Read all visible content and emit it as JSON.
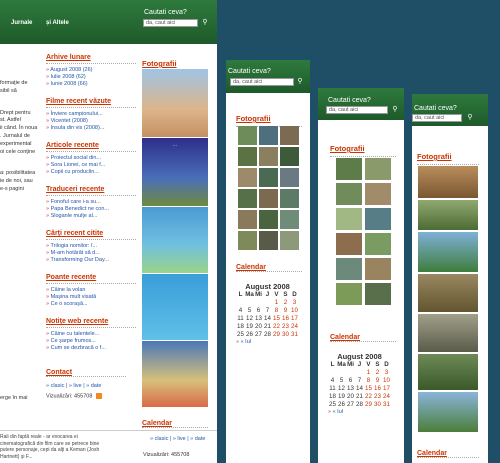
{
  "main": {
    "nav": [
      "Jurnale",
      "și Altele"
    ],
    "search": {
      "label": "Cautati ceva?",
      "placeholder": "da, caut aici"
    },
    "left_text": [
      "formaţie de",
      "sibil să",
      "Drept pentru",
      "st. Astfel",
      "ii când. În noua",
      ". Jurnalul de",
      "experimental",
      "oi cele conţine",
      "a: posibilitatea",
      "ie de noi, sau",
      "e-s pagini",
      "erge în mai"
    ],
    "sections": [
      {
        "title": "Arhive lunare",
        "links": [
          "August 2008 (26)",
          "Iulie 2008 (62)",
          "Iunie 2008 (66)"
        ]
      },
      {
        "title": "Filme recent văzute",
        "links": [
          "Înviere campionului...",
          "Vicentet (2008)",
          "Insula din vis (2008)..."
        ]
      },
      {
        "title": "Articole recente",
        "links": [
          "Proiectul social din...",
          "Sora Lionei, ce mai f...",
          "Copii cu produclin..."
        ]
      },
      {
        "title": "Traduceri recente",
        "links": [
          "Fonoful care i-a su...",
          "Papa Benedict ne con...",
          "Sloganle mulţe al..."
        ]
      },
      {
        "title": "Cărţi recent citite",
        "links": [
          "Trilogia nomilor: î...",
          "M-am hotărât să d...",
          "Transforming Our Day..."
        ]
      },
      {
        "title": "Poante recente",
        "links": [
          "Câine la volan",
          "Maşina mult visată",
          "Ce o scoraşă..."
        ]
      },
      {
        "title": "Notiţe web recente",
        "links": [
          "Câine cu talentele...",
          "Ce şarpe frumos...",
          "Cum se dezbracă o f..."
        ]
      }
    ],
    "contact": {
      "title": "Contact",
      "feeds": "» clasic | » live | » date",
      "visits": "Vizualizări: 455708"
    },
    "fotografii": "Fotografii",
    "calendar": "Calendar",
    "bottom_text": "Rali din faptă reale - ar evocarea ei cinematografică din film care se petrece bine putere personaje, cepi da alţi a Keman (Josh Hartnett) şi F...",
    "bottom_feeds": "» clasic | » live | » date",
    "bottom_visits": "Vizualizări: 455708"
  },
  "windows": [
    {
      "search_label": "Cautati ceva?",
      "search_placeholder": "da, caut aici",
      "fotografii": "Fotografii",
      "calendar": "Calendar",
      "month": "August 2008"
    },
    {
      "search_label": "Cautati ceva?",
      "search_placeholder": "da, caut aici",
      "fotografii": "Fotografii",
      "calendar": "Calendar",
      "month": "August 2008"
    },
    {
      "search_label": "Cautati ceva?",
      "search_placeholder": "da, caut aici",
      "fotografii": "Fotografii",
      "calendar": "Calendar"
    }
  ],
  "cal_days": [
    "L",
    "Ma",
    "Mi",
    "J",
    "V",
    "S",
    "D"
  ],
  "cal_rows": [
    [
      "",
      "",
      "",
      "",
      "1",
      "2",
      "3"
    ],
    [
      "4",
      "5",
      "6",
      "7",
      "8",
      "9",
      "10"
    ],
    [
      "11",
      "12",
      "13",
      "14",
      "15",
      "16",
      "17"
    ],
    [
      "18",
      "19",
      "20",
      "21",
      "22",
      "23",
      "24"
    ],
    [
      "25",
      "26",
      "27",
      "28",
      "29",
      "30",
      "31"
    ]
  ],
  "cal_prev": "« Iul",
  "icons": {
    "search": "magnifier-icon",
    "rss": "rss-feed-icon"
  }
}
